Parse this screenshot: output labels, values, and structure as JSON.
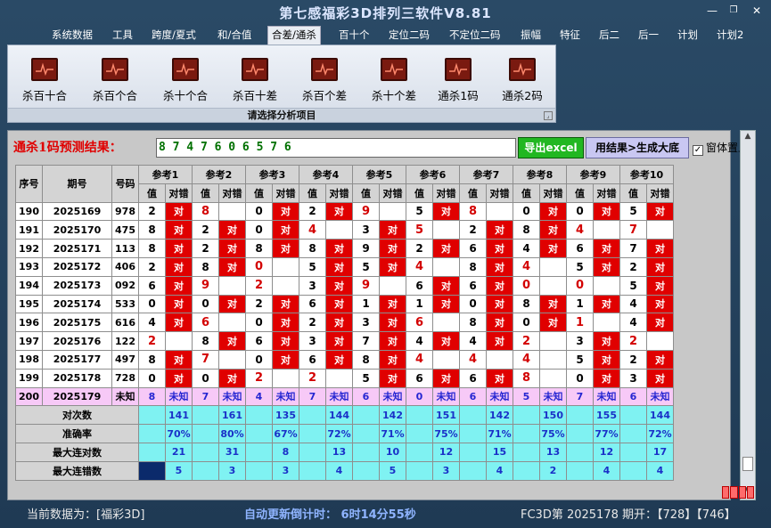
{
  "window": {
    "title": "第七感福彩3D排列三软件V8.81",
    "min": "—",
    "restore": "❐",
    "close": "✕"
  },
  "menu": [
    "系统数据",
    "工具",
    "跨度/夏式",
    "和/合值",
    "合差/通杀",
    "百十个",
    "定位二码",
    "不定位二码",
    "振幅",
    "特征",
    "后二",
    "后一",
    "计划",
    "计划2"
  ],
  "menu_active": "合差/通杀",
  "ribbon": {
    "items": [
      "杀百十合",
      "杀百个合",
      "杀十个合",
      "杀百十差",
      "杀百个差",
      "杀十个差",
      "通杀1码",
      "通杀2码"
    ],
    "caption": "请选择分析项目"
  },
  "prediction": {
    "label": "通杀1码预测结果：",
    "value": "8 7 4 7 6 0 6 5 7 6"
  },
  "buttons": {
    "excel": "导出excel",
    "generate": "用结果>生成大底",
    "stay_on_top": "窗体置上"
  },
  "table": {
    "headers": {
      "seq": "序号",
      "period": "期号",
      "number": "号码",
      "ref_prefix": "参考",
      "value": "值",
      "hit": "对错"
    },
    "ref_count": 10,
    "rows": [
      {
        "seq": "190",
        "period": "2025169",
        "num": "978",
        "cells": [
          [
            "2",
            "对"
          ],
          [
            "8",
            ""
          ],
          [
            "0",
            "对"
          ],
          [
            "2",
            "对"
          ],
          [
            "9",
            ""
          ],
          [
            "5",
            "对"
          ],
          [
            "8",
            ""
          ],
          [
            "0",
            "对"
          ],
          [
            "0",
            "对"
          ],
          [
            "5",
            "对"
          ]
        ]
      },
      {
        "seq": "191",
        "period": "2025170",
        "num": "475",
        "cells": [
          [
            "8",
            "对"
          ],
          [
            "2",
            "对"
          ],
          [
            "0",
            "对"
          ],
          [
            "4",
            ""
          ],
          [
            "3",
            "对"
          ],
          [
            "5",
            ""
          ],
          [
            "2",
            "对"
          ],
          [
            "8",
            "对"
          ],
          [
            "4",
            ""
          ],
          [
            "7",
            ""
          ]
        ]
      },
      {
        "seq": "192",
        "period": "2025171",
        "num": "113",
        "cells": [
          [
            "8",
            "对"
          ],
          [
            "2",
            "对"
          ],
          [
            "8",
            "对"
          ],
          [
            "8",
            "对"
          ],
          [
            "9",
            "对"
          ],
          [
            "2",
            "对"
          ],
          [
            "6",
            "对"
          ],
          [
            "4",
            "对"
          ],
          [
            "6",
            "对"
          ],
          [
            "7",
            "对"
          ]
        ]
      },
      {
        "seq": "193",
        "period": "2025172",
        "num": "406",
        "cells": [
          [
            "2",
            "对"
          ],
          [
            "8",
            "对"
          ],
          [
            "0",
            ""
          ],
          [
            "5",
            "对"
          ],
          [
            "5",
            "对"
          ],
          [
            "4",
            ""
          ],
          [
            "8",
            "对"
          ],
          [
            "4",
            ""
          ],
          [
            "5",
            "对"
          ],
          [
            "2",
            "对"
          ]
        ]
      },
      {
        "seq": "194",
        "period": "2025173",
        "num": "092",
        "cells": [
          [
            "6",
            "对"
          ],
          [
            "9",
            ""
          ],
          [
            "2",
            ""
          ],
          [
            "3",
            "对"
          ],
          [
            "9",
            ""
          ],
          [
            "6",
            "对"
          ],
          [
            "6",
            "对"
          ],
          [
            "0",
            ""
          ],
          [
            "0",
            ""
          ],
          [
            "5",
            "对"
          ]
        ]
      },
      {
        "seq": "195",
        "period": "2025174",
        "num": "533",
        "cells": [
          [
            "0",
            "对"
          ],
          [
            "0",
            "对"
          ],
          [
            "2",
            "对"
          ],
          [
            "6",
            "对"
          ],
          [
            "1",
            "对"
          ],
          [
            "1",
            "对"
          ],
          [
            "0",
            "对"
          ],
          [
            "8",
            "对"
          ],
          [
            "1",
            "对"
          ],
          [
            "4",
            "对"
          ]
        ]
      },
      {
        "seq": "196",
        "period": "2025175",
        "num": "616",
        "cells": [
          [
            "4",
            "对"
          ],
          [
            "6",
            ""
          ],
          [
            "0",
            "对"
          ],
          [
            "2",
            "对"
          ],
          [
            "3",
            "对"
          ],
          [
            "6",
            ""
          ],
          [
            "8",
            "对"
          ],
          [
            "0",
            "对"
          ],
          [
            "1",
            ""
          ],
          [
            "4",
            "对"
          ]
        ]
      },
      {
        "seq": "197",
        "period": "2025176",
        "num": "122",
        "cells": [
          [
            "2",
            ""
          ],
          [
            "8",
            "对"
          ],
          [
            "6",
            "对"
          ],
          [
            "3",
            "对"
          ],
          [
            "7",
            "对"
          ],
          [
            "4",
            "对"
          ],
          [
            "4",
            "对"
          ],
          [
            "2",
            ""
          ],
          [
            "3",
            "对"
          ],
          [
            "2",
            ""
          ]
        ]
      },
      {
        "seq": "198",
        "period": "2025177",
        "num": "497",
        "cells": [
          [
            "8",
            "对"
          ],
          [
            "7",
            ""
          ],
          [
            "0",
            "对"
          ],
          [
            "6",
            "对"
          ],
          [
            "8",
            "对"
          ],
          [
            "4",
            ""
          ],
          [
            "4",
            ""
          ],
          [
            "4",
            ""
          ],
          [
            "5",
            "对"
          ],
          [
            "2",
            "对"
          ]
        ]
      },
      {
        "seq": "199",
        "period": "2025178",
        "num": "728",
        "cells": [
          [
            "0",
            "对"
          ],
          [
            "0",
            "对"
          ],
          [
            "2",
            ""
          ],
          [
            "2",
            ""
          ],
          [
            "5",
            "对"
          ],
          [
            "6",
            "对"
          ],
          [
            "6",
            "对"
          ],
          [
            "8",
            ""
          ],
          [
            "0",
            "对"
          ],
          [
            "3",
            "对"
          ]
        ]
      },
      {
        "seq": "200",
        "period": "2025179",
        "num": "未知",
        "cells": [
          [
            "8",
            "未知"
          ],
          [
            "7",
            "未知"
          ],
          [
            "4",
            "未知"
          ],
          [
            "7",
            "未知"
          ],
          [
            "6",
            "未知"
          ],
          [
            "0",
            "未知"
          ],
          [
            "6",
            "未知"
          ],
          [
            "5",
            "未知"
          ],
          [
            "7",
            "未知"
          ],
          [
            "6",
            "未知"
          ]
        ]
      }
    ],
    "red_values": [
      [
        1
      ],
      [
        3,
        5
      ],
      [],
      [
        2,
        6
      ],
      [
        1,
        2,
        4,
        7,
        8
      ],
      [],
      [
        1,
        5,
        8
      ],
      [
        0,
        7,
        9
      ],
      [
        1,
        5,
        6,
        7
      ],
      [
        2,
        3,
        7
      ]
    ],
    "stats": [
      {
        "label": "对次数",
        "values": [
          "141",
          "161",
          "135",
          "144",
          "142",
          "151",
          "142",
          "150",
          "155",
          "144"
        ]
      },
      {
        "label": "准确率",
        "values": [
          "70%",
          "80%",
          "67%",
          "72%",
          "71%",
          "75%",
          "71%",
          "75%",
          "77%",
          "72%"
        ]
      },
      {
        "label": "最大连对数",
        "values": [
          "21",
          "31",
          "8",
          "13",
          "10",
          "12",
          "15",
          "13",
          "12",
          "17"
        ]
      },
      {
        "label": "最大连错数",
        "values": [
          "5",
          "3",
          "3",
          "4",
          "5",
          "3",
          "4",
          "2",
          "4",
          "4"
        ]
      }
    ]
  },
  "status": {
    "current": "当前数据为：[福彩3D]",
    "countdown": "自动更新倒计时：  6时14分55秒",
    "draw": "FC3D第 2025178 期开：【728】【746】"
  }
}
